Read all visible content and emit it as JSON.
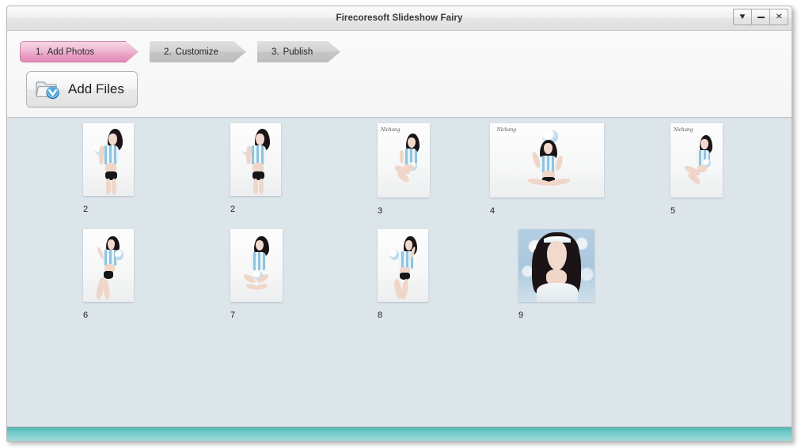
{
  "window": {
    "title": "Firecoresoft Slideshow Fairy",
    "controls": [
      {
        "name": "dropdown",
        "glyph": "▼"
      },
      {
        "name": "minimize",
        "glyph": "─"
      },
      {
        "name": "close",
        "glyph": "✕"
      }
    ]
  },
  "steps": [
    {
      "num": "1.",
      "label": "Add Photos",
      "state": "active"
    },
    {
      "num": "2.",
      "label": "Customize",
      "state": "inactive"
    },
    {
      "num": "3.",
      "label": "Publish",
      "state": "inactive"
    }
  ],
  "toolbar": {
    "add_files_label": "Add Files",
    "add_files_icon": "folder-add-icon"
  },
  "thumbnails": [
    {
      "label": "2",
      "orientation": "portrait",
      "watermark": "",
      "style": "studio-standing"
    },
    {
      "label": "2",
      "orientation": "portrait",
      "watermark": "",
      "style": "studio-standing"
    },
    {
      "label": "3",
      "orientation": "portrait",
      "watermark": "Nichang",
      "style": "studio-sitting"
    },
    {
      "label": "4",
      "orientation": "landscape",
      "watermark": "Nichang",
      "style": "studio-crosslegged"
    },
    {
      "label": "5",
      "orientation": "portrait",
      "watermark": "Nichang",
      "style": "studio-reclining"
    },
    {
      "label": "6",
      "orientation": "portrait",
      "watermark": "",
      "style": "studio-lying"
    },
    {
      "label": "7",
      "orientation": "portrait",
      "watermark": "",
      "style": "studio-sitting"
    },
    {
      "label": "8",
      "orientation": "portrait",
      "watermark": "",
      "style": "studio-lying"
    },
    {
      "label": "9",
      "orientation": "landscape",
      "watermark": "",
      "style": "bokeh-portrait"
    }
  ],
  "colors": {
    "accent_pink": "#e89cc2",
    "content_bg": "#dbe5ea",
    "status_teal": "#64c3c2",
    "titlebar_text": "#35363a"
  }
}
